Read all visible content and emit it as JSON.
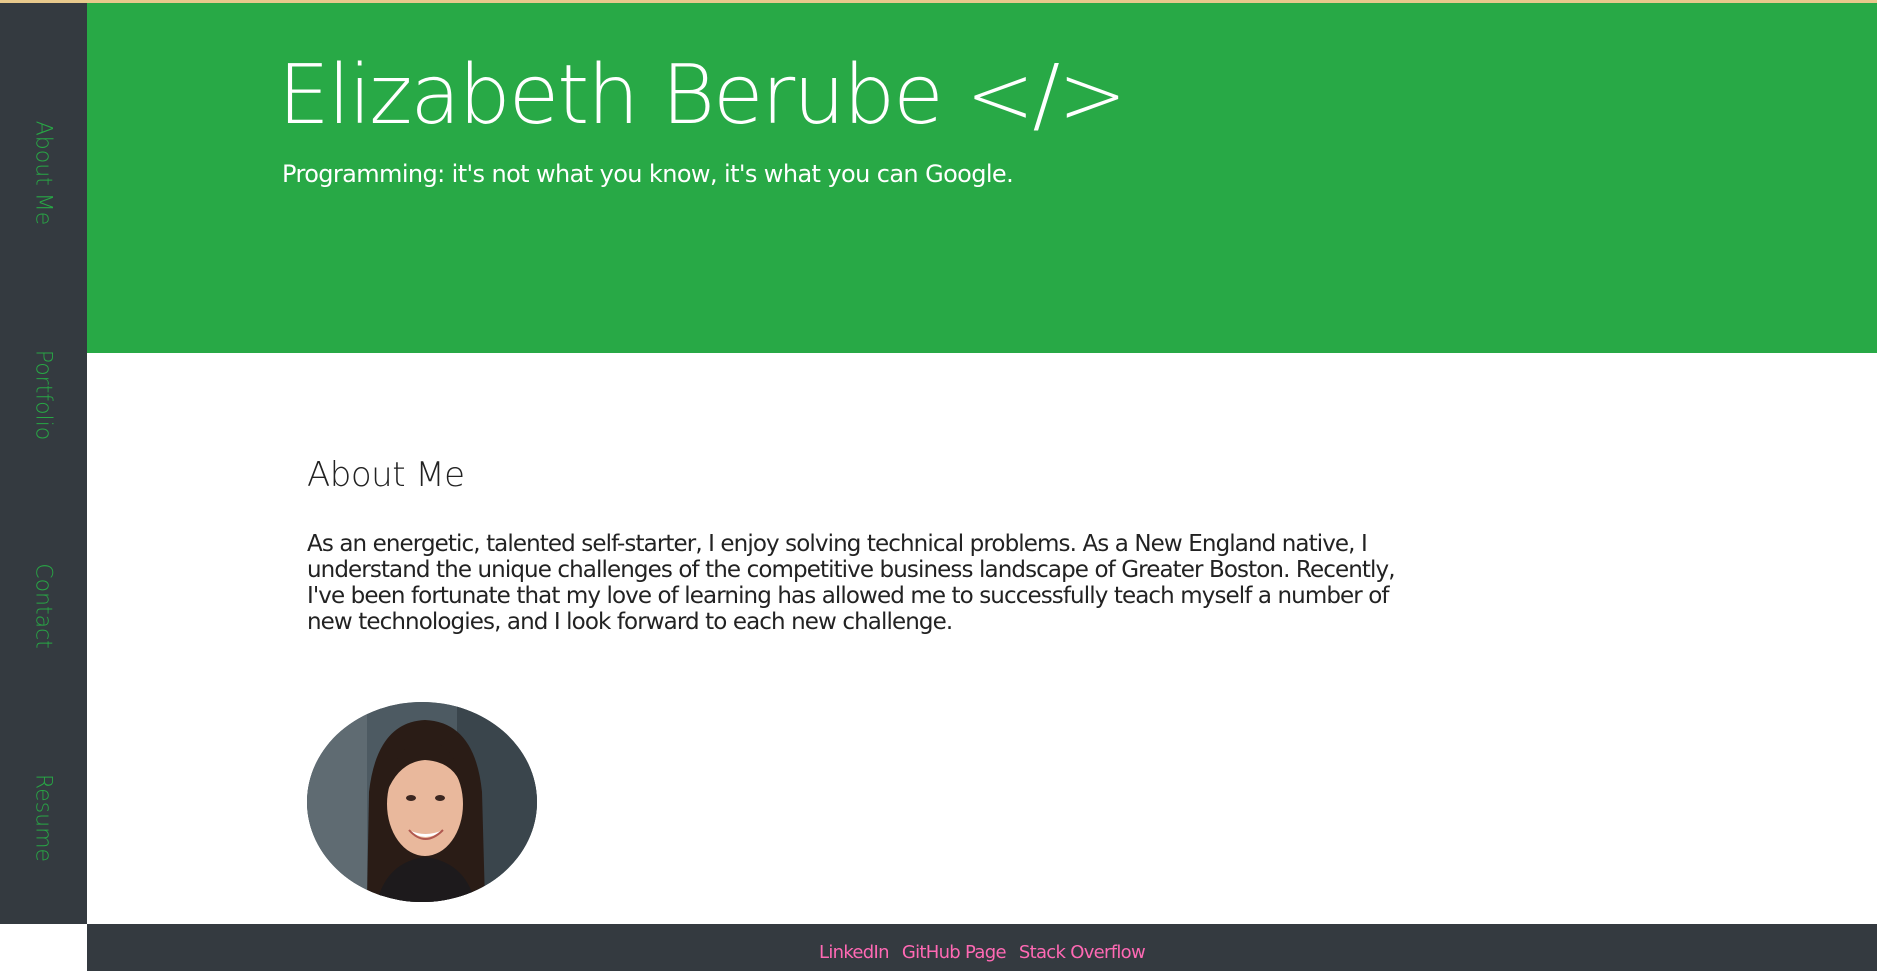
{
  "sidebar": {
    "items": [
      {
        "label": "About Me"
      },
      {
        "label": "Portfolio"
      },
      {
        "label": "Contact"
      },
      {
        "label": "Resume"
      }
    ]
  },
  "header": {
    "title": "Elizabeth Berube </>",
    "subtitle": "Programming: it's not what you know, it's what you can Google."
  },
  "about": {
    "heading": "About Me",
    "body": "As an energetic, talented self-starter, I enjoy solving technical problems. As a New England native, I understand the unique challenges of the competitive business landscape of Greater Boston. Recently, I've been fortunate that my love of learning has allowed me to successfully teach myself a number of new technologies, and I look forward to each new challenge."
  },
  "footer": {
    "links": [
      {
        "label": "LinkedIn"
      },
      {
        "label": "GitHub Page"
      },
      {
        "label": "Stack Overflow"
      }
    ]
  },
  "colors": {
    "hero_green": "#28a946",
    "sidebar_dark": "#343a40",
    "nav_green": "#28a745",
    "footer_link_pink": "#ff69b4"
  }
}
